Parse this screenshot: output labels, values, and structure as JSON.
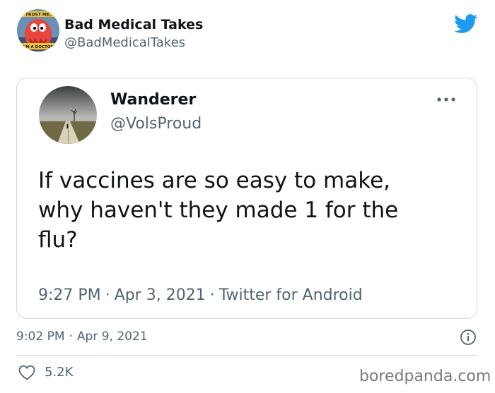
{
  "author": {
    "name": "Bad Medical Takes",
    "handle": "@BadMedicalTakes",
    "avatar_icon": "zoidberg-avatar",
    "avatar_text_top": "TRUST ME,",
    "avatar_text_bottom": "I'M A DOCTOR"
  },
  "brand": {
    "logo_icon": "twitter-bird-icon",
    "color": "#1d9bf0"
  },
  "quoted_tweet": {
    "name": "Wanderer",
    "handle": "@VolsProud",
    "avatar_icon": "landscape-road-avatar",
    "text": "If vaccines are so easy to make,\nwhy haven't they made 1 for the\nflu?",
    "time": "9:27 PM",
    "date": "Apr 3, 2021",
    "source": "Twitter for Android",
    "separator": "·",
    "more_icon": "more-dots-icon"
  },
  "tweet": {
    "time": "9:02 PM",
    "date": "Apr 9, 2021",
    "separator": "·",
    "info_icon": "info-icon",
    "like_icon": "heart-icon",
    "like_count": "5.2K"
  },
  "watermark": "boredpanda.com",
  "colors": {
    "text_primary": "#0f1419",
    "text_secondary": "#536471",
    "border": "#cfd9de"
  }
}
